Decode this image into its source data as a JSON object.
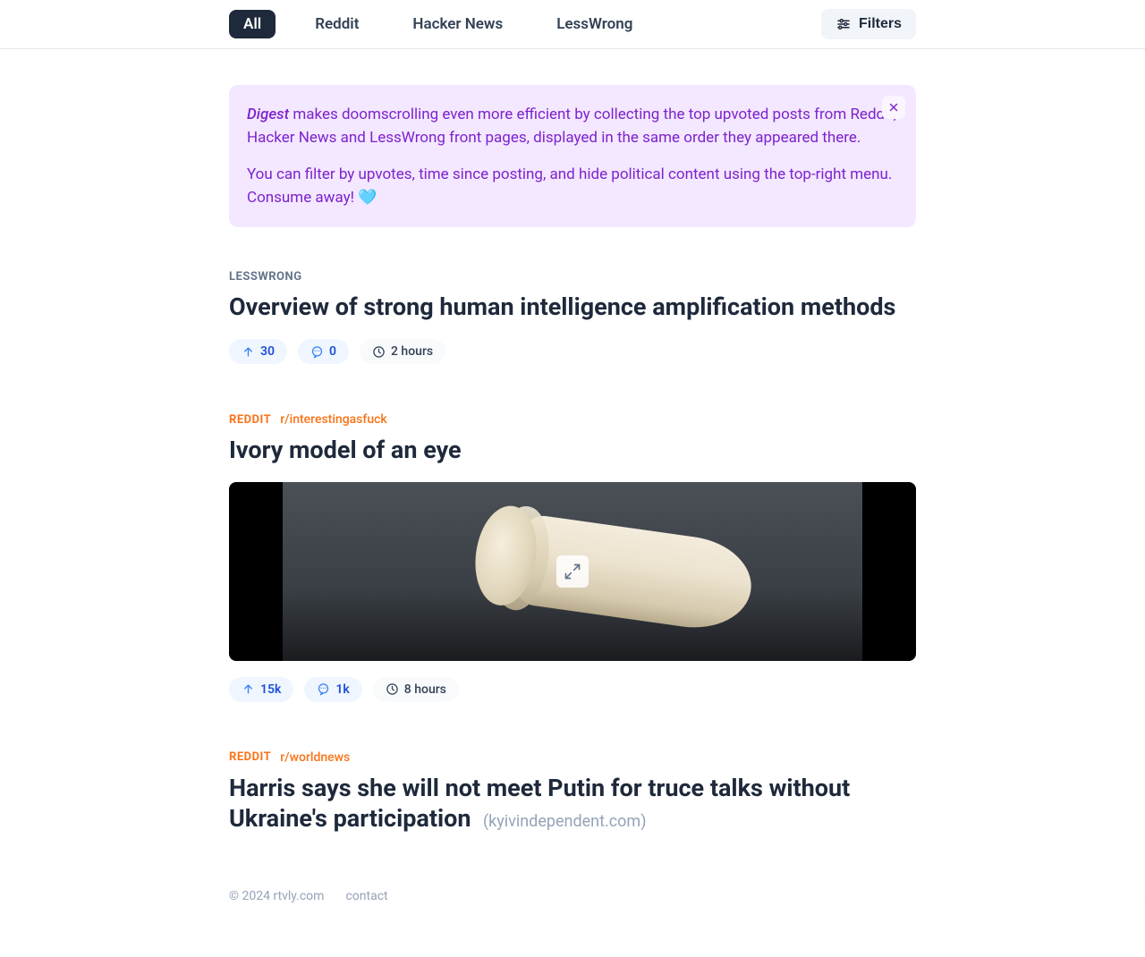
{
  "nav": {
    "tabs": [
      "All",
      "Reddit",
      "Hacker News",
      "LessWrong"
    ],
    "active_index": 0,
    "filters_label": "Filters"
  },
  "banner": {
    "brand": "Digest",
    "p1_rest": " makes doomscrolling even more efficient by collecting the top upvoted posts from Reddit, Hacker News and LessWrong front pages, displayed in the same order they appeared there.",
    "p2": "You can filter by upvotes, time since posting, and hide political content using the top-right menu. Consume away! 🩵"
  },
  "posts": [
    {
      "source": "LESSWRONG",
      "source_class": "lesswrong",
      "subreddit": "",
      "title": "Overview of strong human intelligence amplification methods",
      "domain": "",
      "upvotes": "30",
      "comments": "0",
      "age": "2 hours",
      "has_image": false
    },
    {
      "source": "REDDIT",
      "source_class": "reddit",
      "subreddit": "r/interestingasfuck",
      "title": "Ivory model of an eye",
      "domain": "",
      "upvotes": "15k",
      "comments": "1k",
      "age": "8 hours",
      "has_image": true
    },
    {
      "source": "REDDIT",
      "source_class": "reddit",
      "subreddit": "r/worldnews",
      "title": "Harris says she will not meet Putin for truce talks without Ukraine's participation",
      "domain": "(kyivindependent.com)",
      "upvotes": "",
      "comments": "",
      "age": "",
      "has_image": false
    }
  ],
  "footer": {
    "copyright": "© 2024 rtvly.com",
    "contact": "contact"
  }
}
